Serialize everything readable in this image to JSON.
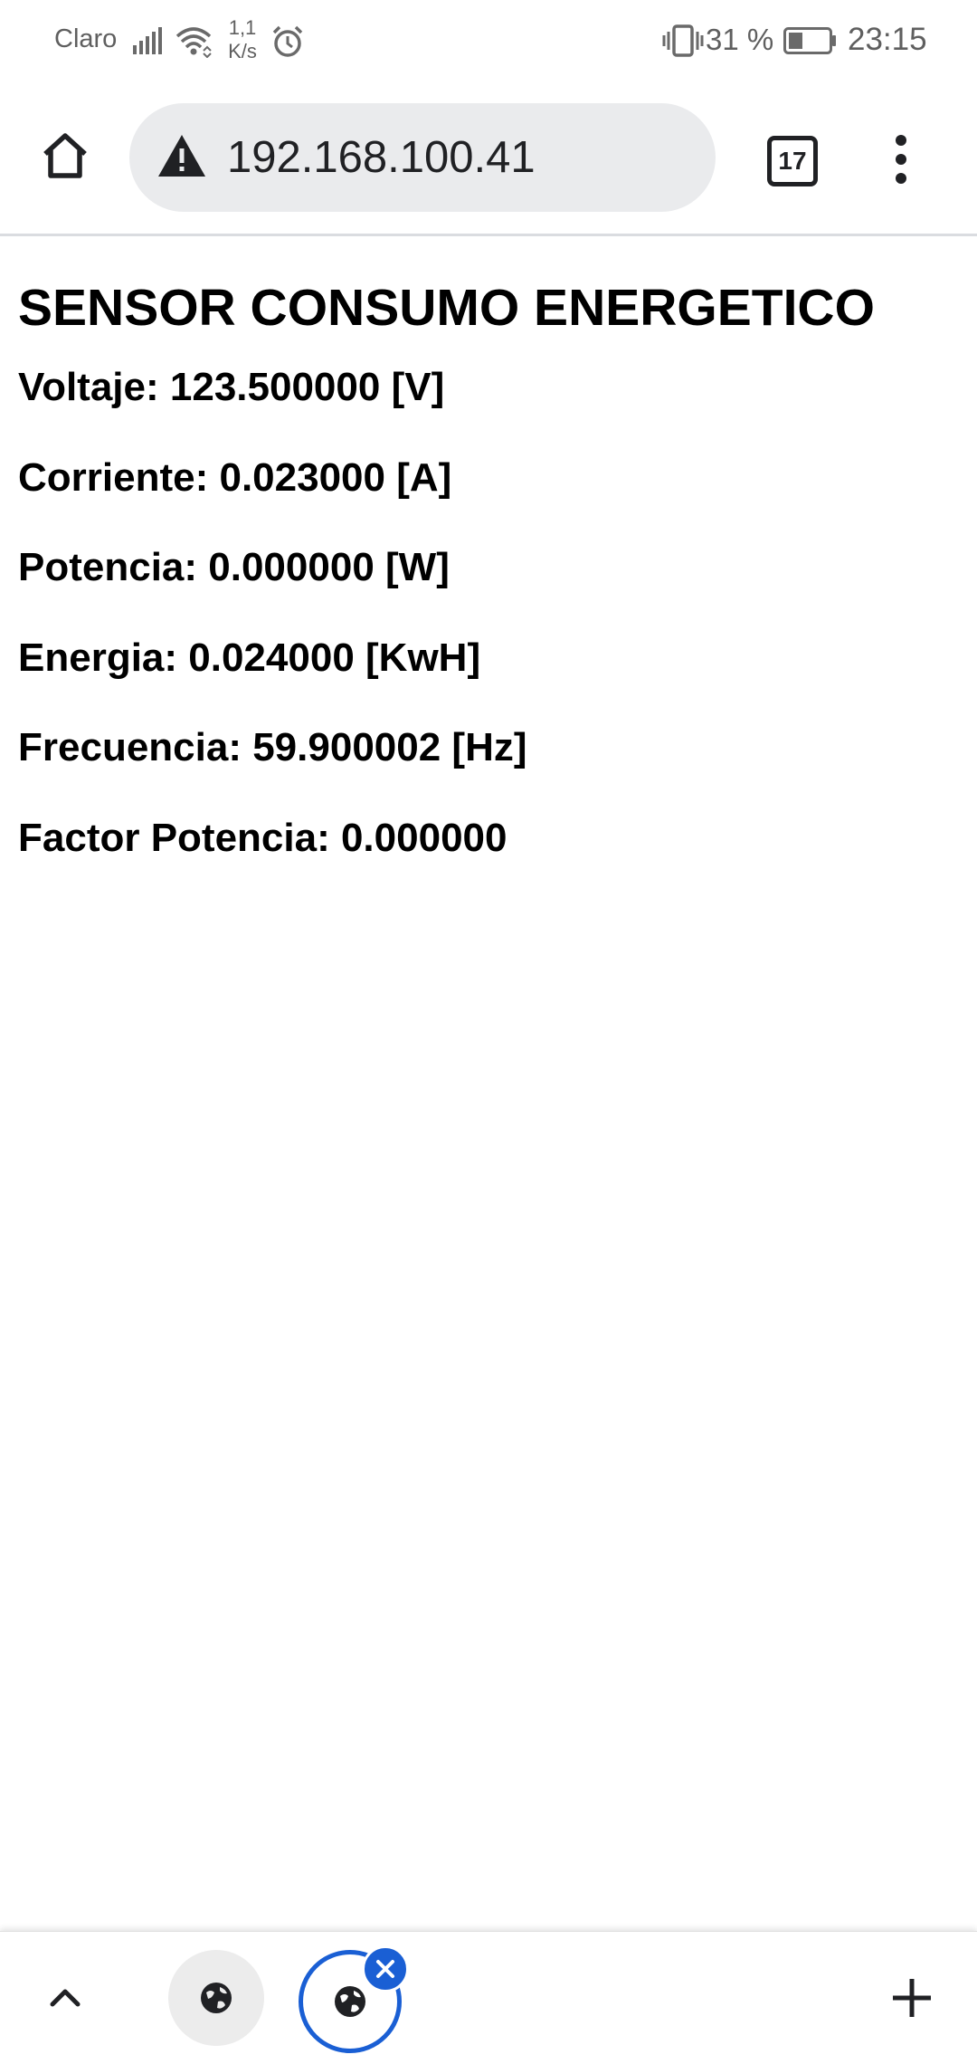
{
  "status_bar": {
    "carrier": "Claro",
    "data_speed_value": "1,1",
    "data_speed_unit": "K/s",
    "battery_percent": "31 %",
    "time": "23:15",
    "icons": [
      "signal-icon",
      "wifi-icon",
      "alarm-icon",
      "vibrate-icon",
      "battery-icon"
    ]
  },
  "browser": {
    "url": "192.168.100.41",
    "security_icon": "warning-icon",
    "tab_count": "17",
    "home_icon": "home-icon",
    "menu_icon": "more-vert-icon"
  },
  "page": {
    "title": "SENSOR CONSUMO ENERGETICO",
    "readings": [
      "Voltaje: 123.500000 [V]",
      "Corriente: 0.023000 [A]",
      "Potencia: 0.000000 [W]",
      "Energia: 0.024000 [KwH]",
      "Frecuencia: 59.900002 [Hz]",
      "Factor Potencia: 0.000000"
    ]
  },
  "bottom_bar": {
    "icons": [
      "chevron-up-icon",
      "globe-icon",
      "globe-icon",
      "close-icon",
      "plus-icon"
    ],
    "accent_color": "#1a5fd4"
  }
}
